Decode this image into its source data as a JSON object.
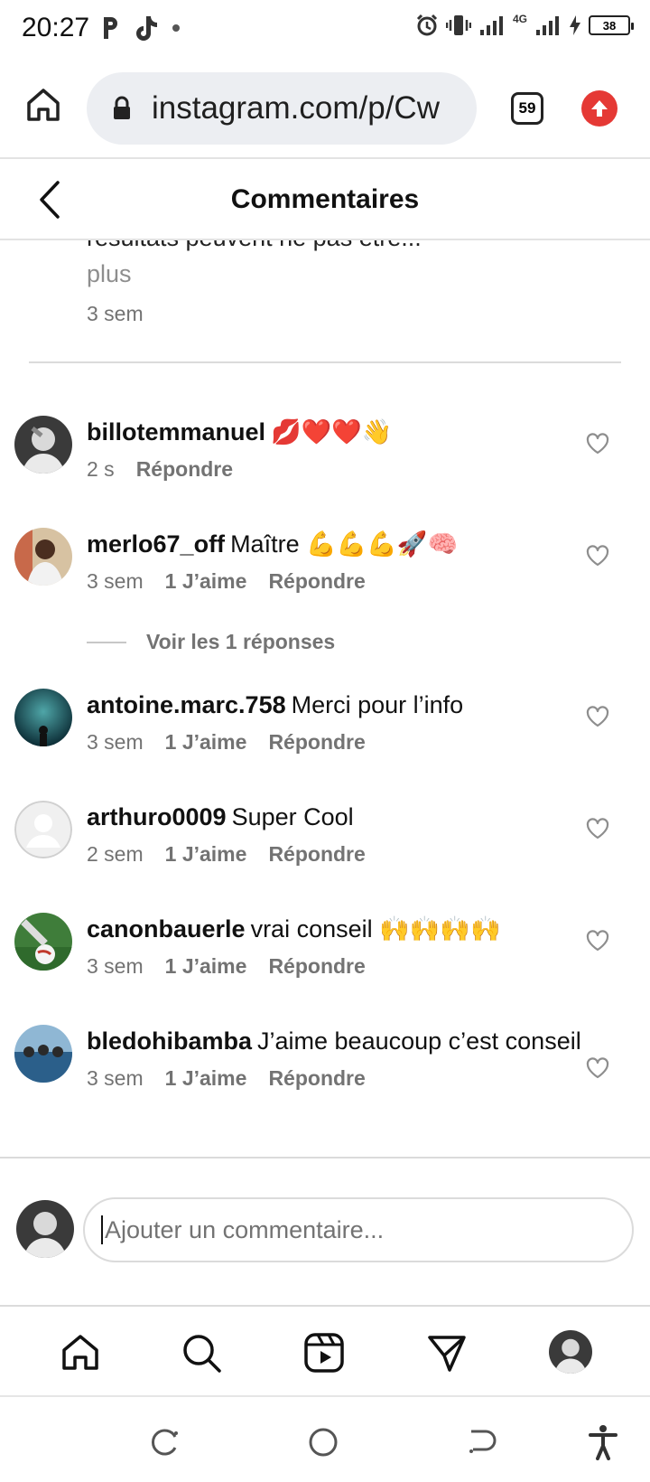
{
  "status_bar": {
    "time": "20:27",
    "battery": "38",
    "network": "4G"
  },
  "browser": {
    "url": "instagram.com/p/Cw",
    "tab_count": "59"
  },
  "header": {
    "title": "Commentaires"
  },
  "caption": {
    "truncated_text": "résultats peuvent ne pas être...",
    "more_label": "plus",
    "time": "3 sem"
  },
  "comments": [
    {
      "username": "billotemmanuel",
      "text": "💋❤️❤️👋",
      "time": "2 s",
      "likes": "",
      "reply": "Répondre"
    },
    {
      "username": "merlo67_off",
      "text": "Maître 💪💪💪🚀🧠",
      "time": "3 sem",
      "likes": "1 J’aime",
      "reply": "Répondre"
    },
    {
      "username": "antoine.marc.758",
      "text": "Merci pour l’info",
      "time": "3 sem",
      "likes": "1 J’aime",
      "reply": "Répondre"
    },
    {
      "username": "arthuro0009",
      "text": "Super Cool",
      "time": "2 sem",
      "likes": "1 J’aime",
      "reply": "Répondre"
    },
    {
      "username": "canonbauerle",
      "text": "vrai conseil 🙌🙌🙌🙌",
      "time": "3 sem",
      "likes": "1 J’aime",
      "reply": "Répondre"
    },
    {
      "username": "bledohibamba",
      "text": "J’aime beaucoup c’est conseil",
      "time": "3 sem",
      "likes": "1 J’aime",
      "reply": "Répondre"
    }
  ],
  "view_replies_label": "Voir les 1 réponses",
  "composer": {
    "placeholder": "Ajouter un commentaire..."
  },
  "icons": {
    "browser": [
      "home-icon",
      "lock-icon",
      "tabs-icon",
      "update-icon"
    ],
    "nav": [
      "home-icon",
      "search-icon",
      "reels-icon",
      "direct-message-icon",
      "profile-avatar"
    ],
    "system": [
      "recent-apps-icon",
      "home-circle-icon",
      "back-icon",
      "accessibility-icon"
    ]
  },
  "colors": {
    "update_red": "#e53935",
    "meta_gray": "#737373",
    "url_pill": "#eceef2"
  }
}
